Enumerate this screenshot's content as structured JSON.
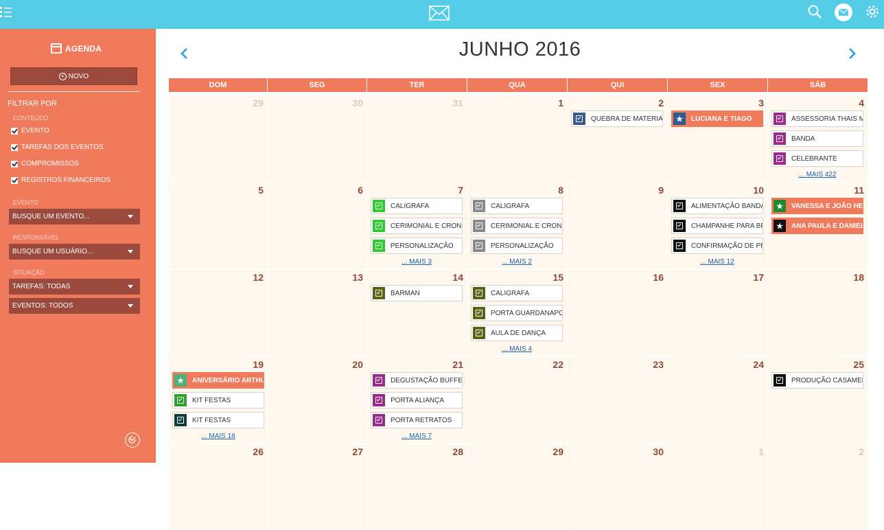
{
  "colors": {
    "topbar": "#55cce6",
    "sidebar": "#f07a5c",
    "dark": "#9b4a3d",
    "accent_text": "#8c4838"
  },
  "sidebar": {
    "title": "AGENDA",
    "new_label": "NOVO",
    "filter_label": "FILTRAR POR",
    "content_label": "CONTEÚDO",
    "checks": [
      "EVENTO",
      "TAREFAS DOS EVENTOS",
      "COMPROMISSOS",
      "REGISTROS FINANCEIROS"
    ],
    "event_label": "EVENTO",
    "event_select": "BUSQUE UM EVENTO...",
    "responsible_label": "RESPONSÁVEL",
    "user_select": "BUSQUE UM USUÁRIO...",
    "situation_label": "SITUAÇÃO",
    "tasks_select": "TAREFAS: TODAS",
    "events_select": "EVENTOS: TODOS"
  },
  "calendar": {
    "title": "JUNHO 2016",
    "weekdays": [
      "DOM",
      "SEG",
      "TER",
      "QUA",
      "QUI",
      "SEX",
      "SÁB"
    ],
    "weeks": [
      [
        {
          "day": "29",
          "faded": true,
          "events": [],
          "more": ""
        },
        {
          "day": "30",
          "faded": true,
          "events": [],
          "more": ""
        },
        {
          "day": "31",
          "faded": true,
          "events": [],
          "more": ""
        },
        {
          "day": "1",
          "events": [],
          "more": ""
        },
        {
          "day": "2",
          "events": [
            {
              "label": "QUEBRA DE MATERIA",
              "color": "#3a5a8c",
              "icon": "check"
            }
          ],
          "more": ""
        },
        {
          "day": "3",
          "events": [
            {
              "label": "LUCIANA E TIAGO",
              "color": "#2f5a8c",
              "icon": "star",
              "hl": true
            }
          ],
          "more": ""
        },
        {
          "day": "4",
          "events": [
            {
              "label": "ASSESSORIA THAIS M",
              "color": "#9c2a8c",
              "icon": "check"
            },
            {
              "label": "BANDA",
              "color": "#9c2a8c",
              "icon": "check"
            },
            {
              "label": "CELEBRANTE",
              "color": "#9c2a8c",
              "icon": "check"
            }
          ],
          "more": "... MAIS 422"
        }
      ],
      [
        {
          "day": "5",
          "events": [],
          "more": ""
        },
        {
          "day": "6",
          "events": [],
          "more": ""
        },
        {
          "day": "7",
          "events": [
            {
              "label": "CALIGRAFA",
              "color": "#2ecc2e",
              "icon": "check"
            },
            {
              "label": "CERIMONIAL E CRONO",
              "color": "#2ecc2e",
              "icon": "check"
            },
            {
              "label": "PERSONALIZAÇÃO",
              "color": "#2ecc2e",
              "icon": "check"
            }
          ],
          "more": "... MAIS 3"
        },
        {
          "day": "8",
          "events": [
            {
              "label": "CALIGRAFA",
              "color": "#8a8a8a",
              "icon": "check"
            },
            {
              "label": "CERIMONIAL E CRONO",
              "color": "#8a8a8a",
              "icon": "check"
            },
            {
              "label": "PERSONALIZAÇÃO",
              "color": "#8a8a8a",
              "icon": "check"
            }
          ],
          "more": "... MAIS 2"
        },
        {
          "day": "9",
          "events": [],
          "more": ""
        },
        {
          "day": "10",
          "events": [
            {
              "label": "ALIMENTAÇÃO BANDA",
              "color": "#111111",
              "icon": "check"
            },
            {
              "label": "CHAMPANHE PARA BR",
              "color": "#111111",
              "icon": "check"
            },
            {
              "label": "CONFIRMAÇÃO DE PR",
              "color": "#111111",
              "icon": "check"
            }
          ],
          "more": "... MAIS 12"
        },
        {
          "day": "11",
          "events": [
            {
              "label": "VANESSA E JOÃO HEN",
              "color": "#1e8a2e",
              "icon": "star",
              "hl": true
            },
            {
              "label": "ANA PAULA E DANIEL",
              "color": "#111111",
              "icon": "star",
              "hl": true
            }
          ],
          "more": ""
        }
      ],
      [
        {
          "day": "12",
          "events": [],
          "more": ""
        },
        {
          "day": "13",
          "events": [],
          "more": ""
        },
        {
          "day": "14",
          "events": [
            {
              "label": "BARMAN",
              "color": "#5a6218",
              "icon": "check"
            }
          ],
          "more": ""
        },
        {
          "day": "15",
          "events": [
            {
              "label": "CALIGRAFA",
              "color": "#5a6218",
              "icon": "check"
            },
            {
              "label": "PORTA GUARDANAPO",
              "color": "#5a6218",
              "icon": "check"
            },
            {
              "label": "AULA DE DANÇA",
              "color": "#5a6218",
              "icon": "check"
            }
          ],
          "more": "... MAIS 4"
        },
        {
          "day": "16",
          "events": [],
          "more": ""
        },
        {
          "day": "17",
          "events": [],
          "more": ""
        },
        {
          "day": "18",
          "events": [],
          "more": ""
        }
      ],
      [
        {
          "day": "19",
          "events": [
            {
              "label": "ANIVERSÁRIO ARTHU",
              "color": "#4bb07a",
              "icon": "star",
              "hl": true
            },
            {
              "label": "KIT FESTAS",
              "color": "#2ea02e",
              "icon": "check"
            },
            {
              "label": "KIT FESTAS",
              "color": "#123a3a",
              "icon": "check"
            }
          ],
          "more": "... MAIS 18"
        },
        {
          "day": "20",
          "events": [],
          "more": ""
        },
        {
          "day": "21",
          "events": [
            {
              "label": "DEGUSTAÇÃO BUFFET",
              "color": "#9c2a8c",
              "icon": "check"
            },
            {
              "label": "PORTA ALIANÇA",
              "color": "#9c2a8c",
              "icon": "check"
            },
            {
              "label": "PORTA RETRATOS",
              "color": "#9c2a8c",
              "icon": "check"
            }
          ],
          "more": "... MAIS 7"
        },
        {
          "day": "22",
          "events": [],
          "more": ""
        },
        {
          "day": "23",
          "events": [],
          "more": ""
        },
        {
          "day": "24",
          "events": [],
          "more": ""
        },
        {
          "day": "25",
          "events": [
            {
              "label": "PRODUÇÃO CASAMENT",
              "color": "#111111",
              "icon": "check"
            }
          ],
          "more": ""
        }
      ],
      [
        {
          "day": "26",
          "events": [],
          "more": ""
        },
        {
          "day": "27",
          "events": [],
          "more": ""
        },
        {
          "day": "28",
          "events": [],
          "more": ""
        },
        {
          "day": "29",
          "events": [],
          "more": ""
        },
        {
          "day": "30",
          "events": [],
          "more": ""
        },
        {
          "day": "1",
          "faded": true,
          "events": [],
          "more": ""
        },
        {
          "day": "2",
          "faded": true,
          "events": [],
          "more": ""
        }
      ]
    ]
  }
}
